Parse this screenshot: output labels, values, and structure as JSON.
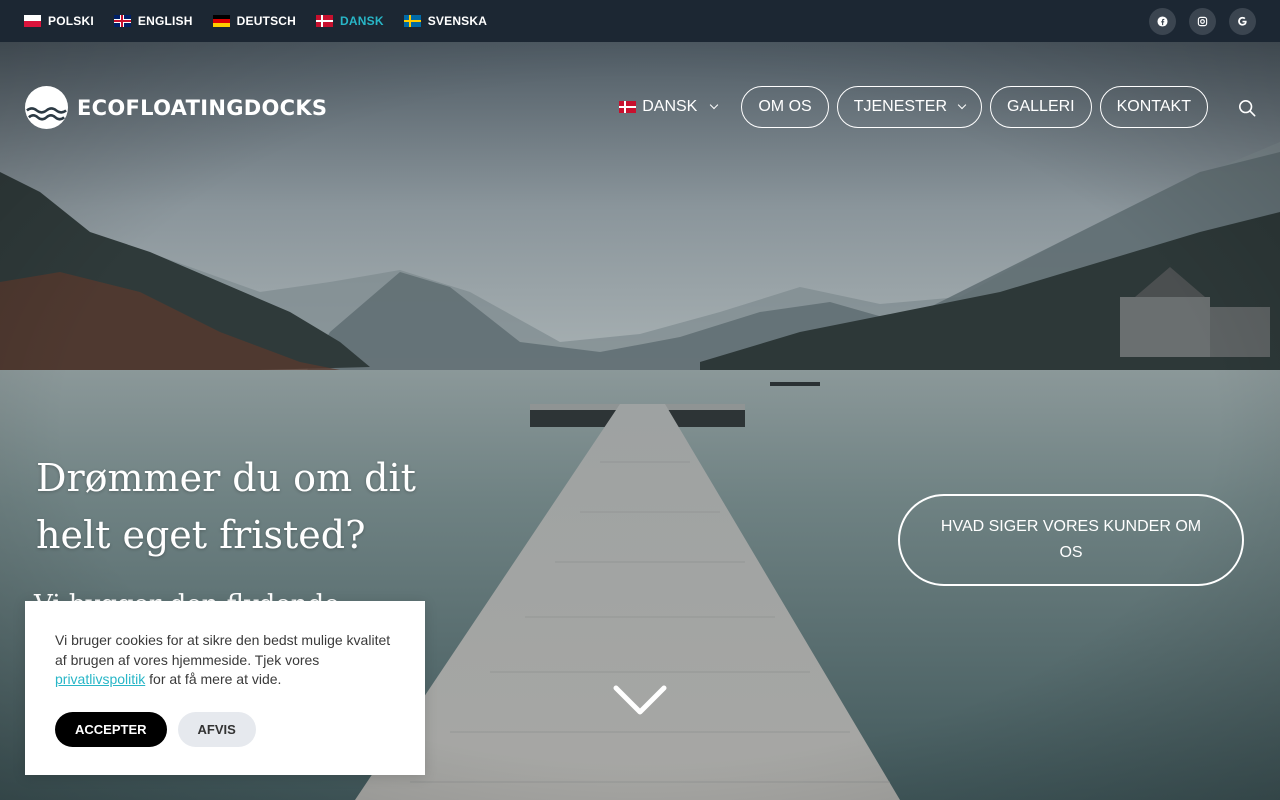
{
  "topbar": {
    "languages": [
      {
        "label": "POLSKI",
        "flag": "pl"
      },
      {
        "label": "ENGLISH",
        "flag": "gb"
      },
      {
        "label": "DEUTSCH",
        "flag": "de"
      },
      {
        "label": "DANSK",
        "flag": "dk",
        "active": true
      },
      {
        "label": "SVENSKA",
        "flag": "se"
      }
    ],
    "socials": [
      {
        "icon": "facebook-icon",
        "glyph": "f"
      },
      {
        "icon": "instagram-icon",
        "glyph": "◎"
      },
      {
        "icon": "google-icon",
        "glyph": "G"
      }
    ]
  },
  "header": {
    "logo_text": "ECOFLOATINGDOCKS",
    "lang_selector": "DANSK",
    "nav": {
      "om_os": "OM OS",
      "tjenester": "TJENESTER",
      "galleri": "GALLERI",
      "kontakt": "KONTAKT"
    }
  },
  "hero": {
    "headline": "Drømmer du om dit helt eget fristed?",
    "subline": "Vi bygger den flydende",
    "cta": "HVAD SIGER VORES KUNDER OM OS"
  },
  "cookie": {
    "text_before": "Vi bruger cookies for at sikre den bedst mulige kvalitet af brugen af vores hjemmeside. Tjek vores ",
    "link": "privatlivspolitik",
    "text_after": " for at få mere at vide.",
    "accept": "ACCEPTER",
    "reject": "AFVIS"
  },
  "colors": {
    "accent": "#28b6c7",
    "topbar_bg": "#1c2733"
  }
}
